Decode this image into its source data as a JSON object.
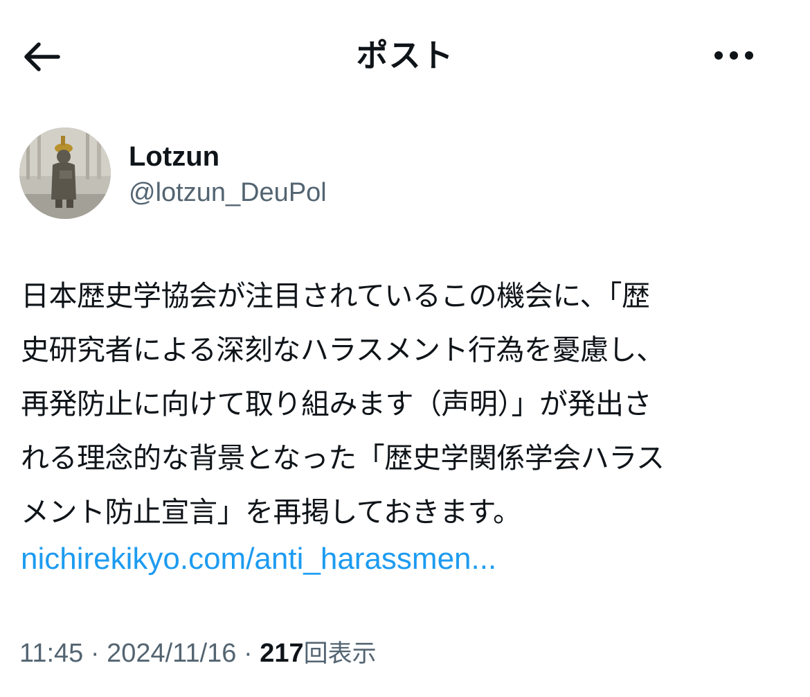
{
  "header": {
    "back_icon": "arrow-left-icon",
    "title": "ポスト",
    "more_icon": "more-horizontal-icon"
  },
  "author": {
    "display_name": "Lotzun",
    "handle": "@lotzun_DeuPol"
  },
  "post": {
    "text": "日本歴史学協会が注目されているこの機会に、「歴\n史研究者による深刻なハラスメント行為を憂慮し、\n再発防止に向けて取り組みます（声明）」が発出さ\nれる理念的な背景となった「歴史学関係学会ハラス\nメント防止宣言」を再掲しておきます。",
    "link_text": "nichirekikyo.com/anti_harassmen..."
  },
  "meta": {
    "time": "11:45",
    "separator": "·",
    "date": "2024/11/16",
    "views_count": "217",
    "views_label": "回表示"
  },
  "colors": {
    "text": "#0f1419",
    "secondary": "#536471",
    "link": "#1d9bf0",
    "background": "#ffffff"
  }
}
